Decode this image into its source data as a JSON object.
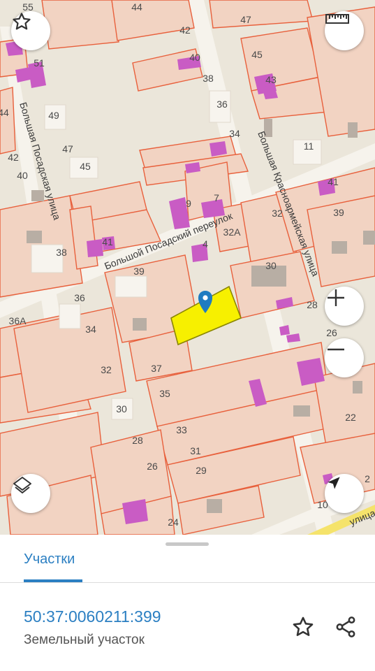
{
  "map": {
    "house_numbers": [
      "55",
      "44",
      "42",
      "40",
      "38",
      "36",
      "34",
      "47",
      "45",
      "43",
      "11",
      "51",
      "49",
      "47",
      "45",
      "44",
      "42",
      "40",
      "41",
      "39",
      "7",
      "9",
      "32",
      "32А",
      "4",
      "41",
      "38",
      "39",
      "30",
      "28",
      "26",
      "36",
      "36А",
      "34",
      "32",
      "37",
      "35",
      "33",
      "31",
      "29",
      "30",
      "28",
      "26",
      "24",
      "22",
      "2",
      "10"
    ],
    "streets": [
      "Большая Посадская улица",
      "Большой Посадский переулок",
      "Большая Красноармейская улица",
      "улица"
    ],
    "colors": {
      "background": "#ebe6da",
      "parcel_fill": "#f2d3c2",
      "parcel_stroke": "#e8603c",
      "building": "#c95cc4",
      "selected_parcel": "#f7f000",
      "pin": "#1f7cc1"
    }
  },
  "controls": {
    "favorite_icon": "star-outline-icon",
    "ruler_icon": "ruler-icon",
    "zoom_in_icon": "plus-icon",
    "zoom_out_icon": "minus-icon",
    "layers_icon": "layers-icon",
    "locate_icon": "navigation-arrow-icon"
  },
  "sheet": {
    "tab_label": "Участки",
    "cadastral_number": "50:37:0060211:399",
    "property_type": "Земельный участок",
    "favorite_icon": "star-outline-icon",
    "share_icon": "share-icon"
  }
}
